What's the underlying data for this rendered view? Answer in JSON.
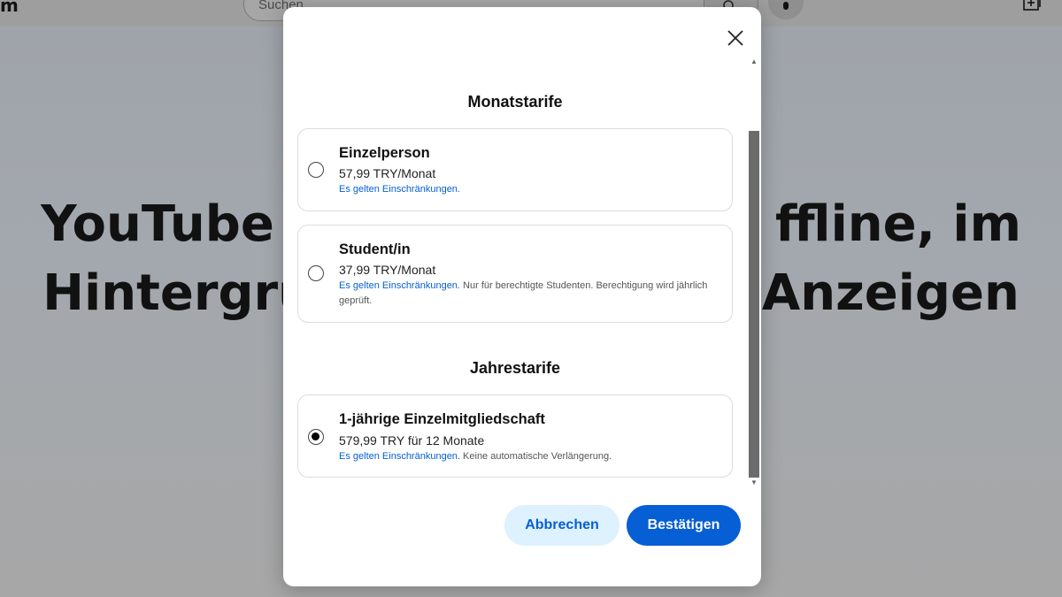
{
  "background": {
    "logo_fragment": "m",
    "search": {
      "placeholder": "Suchen"
    },
    "hero_line1": "YouTube u                          ffline, im",
    "hero_line2": "Hintergru                          Anzeigen"
  },
  "modal": {
    "monthly_section_title": "Monatstarife",
    "yearly_section_title": "Jahrestarife",
    "plans": [
      {
        "name": "Einzelperson",
        "price": "57,99 TRY/Monat",
        "restrictions_link": "Es gelten Einschränkungen.",
        "note": "",
        "selected": false
      },
      {
        "name": "Student/in",
        "price": "37,99 TRY/Monat",
        "restrictions_link": "Es gelten Einschränkungen.",
        "note": " Nur für berechtigte Studenten. Berechtigung wird jährlich geprüft.",
        "selected": false
      },
      {
        "name": "1-jährige Einzelmitgliedschaft",
        "price": "579,99 TRY für 12 Monate",
        "restrictions_link": "Es gelten Einschränkungen.",
        "note": " Keine automatische Verlängerung.",
        "selected": true
      }
    ],
    "cancel_label": "Abbrechen",
    "confirm_label": "Bestätigen"
  },
  "colors": {
    "accent": "#065fd4",
    "cancel_bg": "#def1ff"
  },
  "icons": {
    "close": "close-icon",
    "mic": "mic-icon",
    "search": "search-icon",
    "create": "create-icon"
  }
}
